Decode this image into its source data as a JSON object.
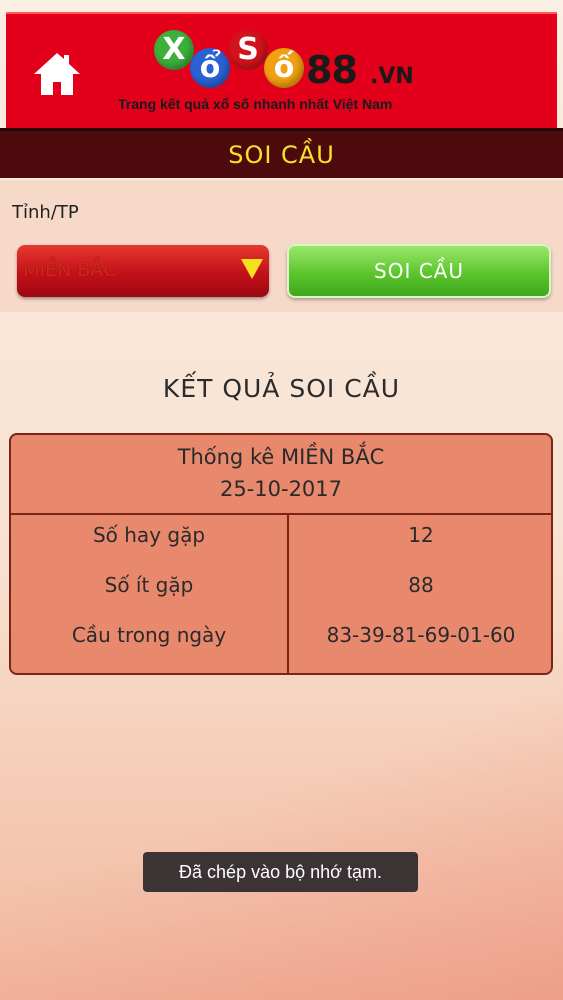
{
  "header": {
    "logo_letters": [
      "X",
      "ổ",
      "S",
      "ố"
    ],
    "logo_number": "88",
    "logo_domain": ".VN",
    "tagline": "Trang kết quả xổ số nhanh nhất Việt Nam",
    "colors": {
      "header_bg": "#e2001a",
      "ball_green": "#3bb03b",
      "ball_blue": "#2a62d6",
      "ball_red": "#d2121c",
      "ball_orange": "#f0a010"
    }
  },
  "title_bar": {
    "title": "SOI CẦU"
  },
  "filter": {
    "label": "Tỉnh/TP",
    "selected_region": "MIỀN BẮC",
    "submit_label": "SOI CẦU"
  },
  "results": {
    "heading": "KẾT QUẢ SOI CẦU",
    "table_title": "Thống kê MIỀN BẮC",
    "table_date": "25-10-2017",
    "rows": [
      {
        "label": "Số hay gặp",
        "value": "12"
      },
      {
        "label": "Số ít gặp",
        "value": "88"
      },
      {
        "label": "Cầu trong ngày",
        "value": "83-39-81-69-01-60"
      }
    ]
  },
  "toast": {
    "message": "Đã chép vào bộ nhớ tạm."
  }
}
